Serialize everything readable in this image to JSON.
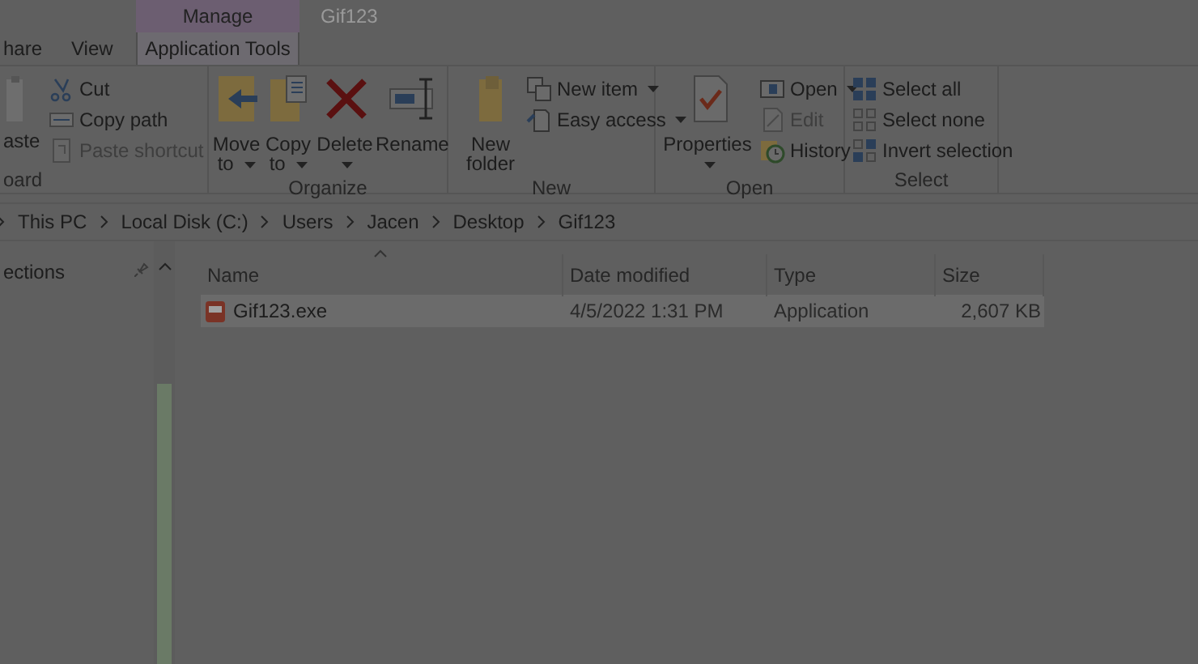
{
  "title_bar": {
    "context_tab": "Manage",
    "title": "Gif123"
  },
  "tabs": [
    {
      "label": "hare",
      "selected": false
    },
    {
      "label": "View",
      "selected": false
    },
    {
      "label": "Application Tools",
      "selected": true
    }
  ],
  "ribbon": [
    {
      "label": "oard",
      "large": [
        {
          "label": "aste",
          "has_menu": false
        }
      ],
      "small": [
        {
          "label": "Cut",
          "has_menu": false,
          "disabled": false
        },
        {
          "label": "Copy path",
          "has_menu": false,
          "disabled": false
        },
        {
          "label": "Paste shortcut",
          "has_menu": false,
          "disabled": true
        }
      ]
    },
    {
      "label": "Organize",
      "large": [
        {
          "label": "Move to",
          "has_menu": true
        },
        {
          "label": "Copy to",
          "has_menu": true
        },
        {
          "label": "Delete",
          "has_menu": true
        },
        {
          "label": "Rename",
          "has_menu": false
        }
      ]
    },
    {
      "label": "New",
      "large": [
        {
          "label": "New folder",
          "has_menu": false
        }
      ],
      "small": [
        {
          "label": "New item",
          "has_menu": true,
          "disabled": false
        },
        {
          "label": "Easy access",
          "has_menu": true,
          "disabled": false
        }
      ]
    },
    {
      "label": "Open",
      "large": [
        {
          "label": "Properties",
          "has_menu": true
        }
      ],
      "small": [
        {
          "label": "Open",
          "has_menu": true,
          "disabled": false
        },
        {
          "label": "Edit",
          "has_menu": false,
          "disabled": true
        },
        {
          "label": "History",
          "has_menu": false,
          "disabled": false
        }
      ]
    },
    {
      "label": "Select",
      "small": [
        {
          "label": "Select all",
          "has_menu": false,
          "disabled": false
        },
        {
          "label": "Select none",
          "has_menu": false,
          "disabled": false
        },
        {
          "label": "Invert selection",
          "has_menu": false,
          "disabled": false
        }
      ]
    }
  ],
  "breadcrumb": [
    "This PC",
    "Local Disk (C:)",
    "Users",
    "Jacen",
    "Desktop",
    "Gif123"
  ],
  "nav_pane": {
    "header": "ections"
  },
  "columns": [
    "Name",
    "Date modified",
    "Type",
    "Size"
  ],
  "rows": [
    {
      "name": "Gif123.exe",
      "date": "4/5/2022 1:31 PM",
      "type": "Application",
      "size": "2,607 KB",
      "selected": true
    }
  ]
}
